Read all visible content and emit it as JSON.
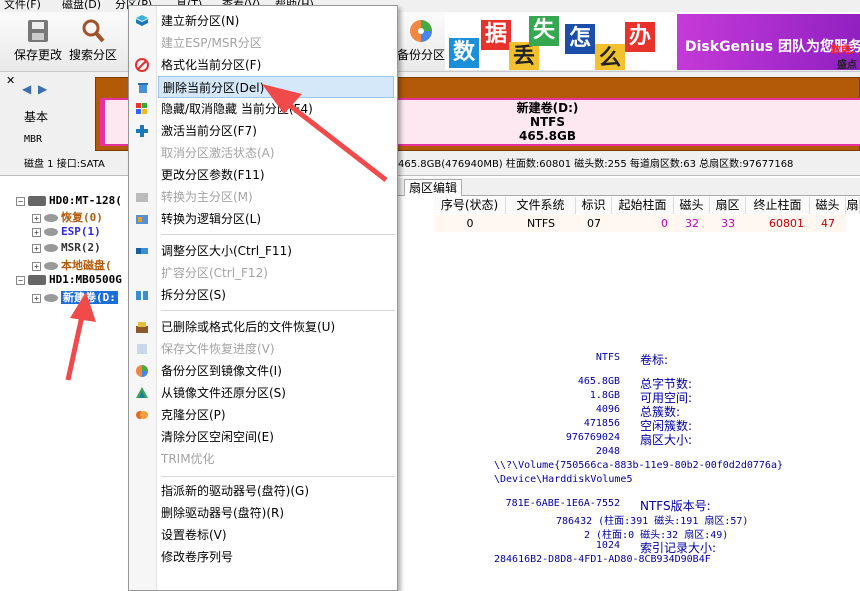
{
  "menubar": {
    "items": [
      "文件(F)",
      "磁盘(D)",
      "分区(P)",
      "具(T)",
      "查看(V)",
      "帮助(H)"
    ]
  },
  "toolbar": {
    "save": "保存更改",
    "search": "搜索分区",
    "backup": "备份分区"
  },
  "banner": {
    "tiles": [
      "数",
      "据",
      "丢",
      "失",
      "怎",
      "么",
      "办"
    ],
    "text": "DiskGenius 团队为您服务",
    "sub1": "数电:",
    "sub2": "盛点"
  },
  "disk_panel": {
    "basic": "基本",
    "mbr": "MBR",
    "partition_name": "新建卷(D:)",
    "fs": "NTFS",
    "size": "465.8GB",
    "info_left": "磁盘 1 接口:SATA",
    "info_right": "465.8GB(476940MB)  柱面数:60801  磁头数:255  每道扇区数:63  总扇区数:97677168"
  },
  "tree": {
    "hd0": "HD0:MT-128(",
    "p1": "恢复(0)",
    "p2": "ESP(1)",
    "p3": "MSR(2)",
    "p4": "本地磁盘(",
    "hd1": "HD1:MB0500G",
    "p5": "新建卷(D:"
  },
  "tabs": {
    "sector_edit": "扇区编辑"
  },
  "table": {
    "headers": [
      "序号(状态)",
      "文件系统",
      "标识",
      "起始柱面",
      "磁头",
      "扇区",
      "终止柱面",
      "磁头",
      "扇"
    ],
    "row": [
      "0",
      "NTFS",
      "07",
      "0",
      "32",
      "33",
      "60801",
      "47",
      ""
    ]
  },
  "details": {
    "fs_val": "NTFS",
    "fs_lbl": "卷标:",
    "v1": "465.8GB",
    "l1": "总字节数:",
    "v2": "1.8GB",
    "l2": "可用空间:",
    "v3": "4096",
    "l3": "总簇数:",
    "v4": "471856",
    "l4": "空闲簇数:",
    "v5": "976769024",
    "l5": "扇区大小:",
    "v6": "2048",
    "guid": "\\\\?\\Volume{750566ca-883b-11e9-80b2-00f0d2d0776a}",
    "device": "\\Device\\HarddiskVolume5",
    "serial": "781E-6ABE-1E6A-7552",
    "ntfs_ver": "NTFS版本号:",
    "v7": "786432 (柱面:391 磁头:191 扇区:57)",
    "v8": "2 (柱面:0 磁头:32 扇区:49)",
    "v9": "1024",
    "idx_lbl": "索引记录大小:",
    "guid2": "284616B2-D8D8-4FD1-AD80-8CB934D90B4F"
  },
  "context_menu": {
    "items": [
      {
        "label": "建立新分区(N)",
        "disabled": false
      },
      {
        "label": "建立ESP/MSR分区",
        "disabled": true
      },
      {
        "label": "格式化当前分区(F)",
        "disabled": false
      },
      {
        "label": "删除当前分区(Del)",
        "disabled": false
      },
      {
        "label": "隐藏/取消隐藏 当前分区(F4)",
        "disabled": false
      },
      {
        "label": "激活当前分区(F7)",
        "disabled": false
      },
      {
        "label": "取消分区激活状态(A)",
        "disabled": true
      },
      {
        "label": "更改分区参数(F11)",
        "disabled": false
      },
      {
        "label": "转换为主分区(M)",
        "disabled": true
      },
      {
        "label": "转换为逻辑分区(L)",
        "disabled": false
      },
      {
        "label": "调整分区大小(Ctrl_F11)",
        "disabled": false
      },
      {
        "label": "扩容分区(Ctrl_F12)",
        "disabled": true
      },
      {
        "label": "拆分分区(S)",
        "disabled": false
      },
      {
        "label": "已删除或格式化后的文件恢复(U)",
        "disabled": false
      },
      {
        "label": "保存文件恢复进度(V)",
        "disabled": true
      },
      {
        "label": "备份分区到镜像文件(I)",
        "disabled": false
      },
      {
        "label": "从镜像文件还原分区(S)",
        "disabled": false
      },
      {
        "label": "克隆分区(P)",
        "disabled": false
      },
      {
        "label": "清除分区空闲空间(E)",
        "disabled": false
      },
      {
        "label": "TRIM优化",
        "disabled": true
      },
      {
        "label": "指派新的驱动器号(盘符)(G)",
        "disabled": false
      },
      {
        "label": "删除驱动器号(盘符)(R)",
        "disabled": false
      },
      {
        "label": "设置卷标(V)",
        "disabled": false
      },
      {
        "label": "修改卷序列号",
        "disabled": false
      }
    ]
  },
  "colors": {
    "accent_arrow": "#f04a4a",
    "partition_bar": "#e7329d",
    "disk_border": "#b35a08"
  }
}
